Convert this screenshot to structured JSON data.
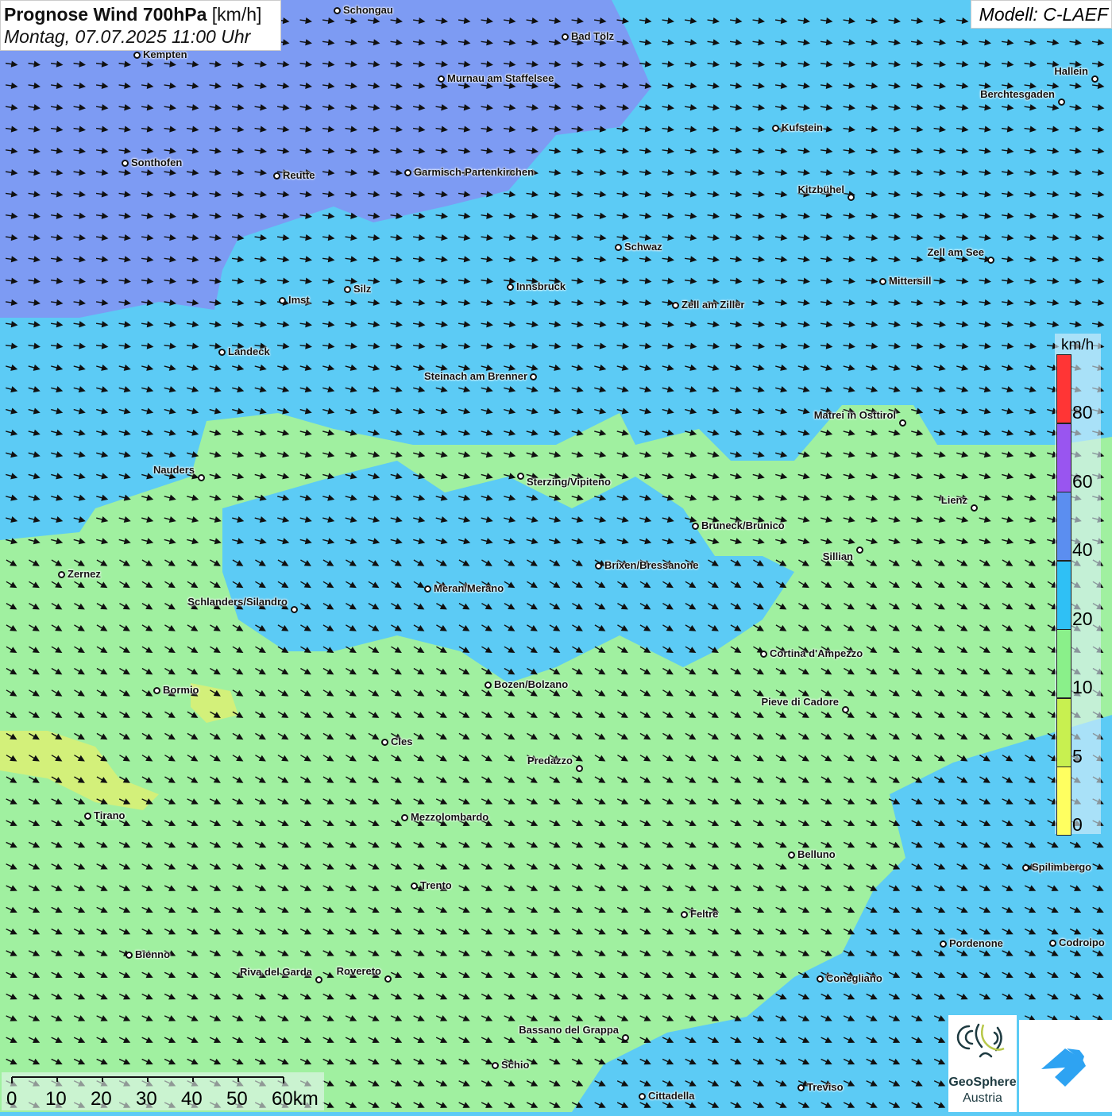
{
  "header": {
    "title_bold": "Prognose Wind 700hPa",
    "title_unit": "[km/h]",
    "datetime": "Montag, 07.07.2025 11:00 Uhr",
    "model": "Modell: C-LAEF"
  },
  "legend": {
    "unit": "km/h",
    "classes": [
      {
        "label": "80",
        "color": "#ff3535"
      },
      {
        "label": "60",
        "color": "#9955f0"
      },
      {
        "label": "40",
        "color": "#5b8ef0"
      },
      {
        "label": "20",
        "color": "#2fc0f5"
      },
      {
        "label": "10",
        "color": "#8af08a"
      },
      {
        "label": "5",
        "color": "#c8f050"
      },
      {
        "label": "0",
        "color": "#ffff60"
      }
    ]
  },
  "scale": {
    "labels": [
      "0",
      "10",
      "20",
      "30",
      "40",
      "50",
      "60km"
    ]
  },
  "cities": [
    "Schongau",
    "Bad Tölz",
    "Kempten",
    "Murnau am Staffelsee",
    "Hallein",
    "Berchtesgaden",
    "Kufstein",
    "Sonthofen",
    "Reutte",
    "Garmisch-Partenkirchen",
    "Kitzbühel",
    "Schwaz",
    "Zell am See",
    "Mittersill",
    "Innsbruck",
    "Imst",
    "Silz",
    "Zell am Ziller",
    "Landeck",
    "Steinach am Brenner",
    "Matrei in Osttirol",
    "Nauders",
    "Sterzing/Vipiteno",
    "Lienz",
    "Bruneck/Brunico",
    "Sillian",
    "Brixen/Bressanone",
    "Zernez",
    "Meran/Merano",
    "Schlanders/Silandro",
    "Cortina d'Ampezzo",
    "Bozen/Bolzano",
    "Bormio",
    "Pieve di Cadore",
    "Cles",
    "Predazzo",
    "Tirano",
    "Mezzolombardo",
    "Belluno",
    "Spilimbergo",
    "Trento",
    "Feltre",
    "Pordenone",
    "Codroipo",
    "Bienno",
    "Riva del Garda",
    "Rovereto",
    "Conegliano",
    "Bassano del Grappa",
    "Schio",
    "Treviso",
    "Cittadella"
  ],
  "logos": {
    "geosphere_line1": "GeoSphere",
    "geosphere_line2": "Austria"
  },
  "colors": {
    "purple_zone": "#7d9bf3",
    "blue_zone": "#5ccbf5",
    "green_zone": "#a0f0a0",
    "yellow_zone": "#e0f070"
  }
}
